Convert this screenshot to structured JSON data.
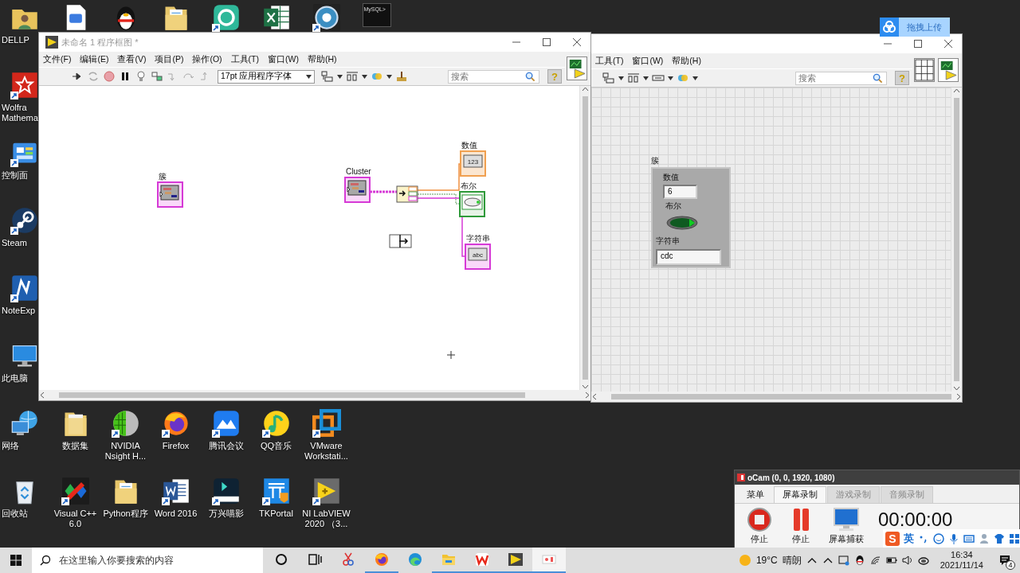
{
  "desktop": {
    "left_column": [
      {
        "kind": "user-folder",
        "label": "DELLP",
        "shortcut": false
      },
      {
        "kind": "wolfram",
        "label": "Wolfra\nMathema",
        "shortcut": true
      },
      {
        "kind": "control-panel",
        "label": "控制面",
        "shortcut": true
      },
      {
        "kind": "steam",
        "label": "Steam",
        "shortcut": true
      },
      {
        "kind": "noteexpress",
        "label": "NoteExp",
        "shortcut": true
      },
      {
        "kind": "computer",
        "label": "此电脑",
        "shortcut": false
      },
      {
        "kind": "network",
        "label": "网络",
        "shortcut": false
      },
      {
        "kind": "recycle",
        "label": "回收站",
        "shortcut": false
      }
    ],
    "top_row": [
      {
        "kind": "wps-doc",
        "shortcut": false
      },
      {
        "kind": "penguin",
        "shortcut": false
      },
      {
        "kind": "folder-docs",
        "shortcut": false
      },
      {
        "kind": "k-app",
        "shortcut": true
      },
      {
        "kind": "excel",
        "shortcut": false
      },
      {
        "kind": "s-app",
        "shortcut": true
      },
      {
        "kind": "terminal",
        "caption": "MySQL>",
        "shortcut": false
      }
    ],
    "bottom_rows": [
      [
        {
          "kind": "folder",
          "label": "数据集",
          "shortcut": false
        },
        {
          "kind": "nvidia",
          "label": "NVIDIA\nNsight H...",
          "shortcut": true
        },
        {
          "kind": "firefox",
          "label": "Firefox",
          "shortcut": true
        },
        {
          "kind": "meeting",
          "label": "腾讯会议",
          "shortcut": true
        },
        {
          "kind": "music",
          "label": "QQ音乐",
          "shortcut": true
        },
        {
          "kind": "vmware",
          "label": "VMware\nWorkstati...",
          "shortcut": true
        }
      ],
      [
        {
          "kind": "vc",
          "label": "Visual C++\n6.0",
          "shortcut": true
        },
        {
          "kind": "folder-docs",
          "label": "Python程序",
          "shortcut": false
        },
        {
          "kind": "word",
          "label": "Word 2016",
          "shortcut": true
        },
        {
          "kind": "wondershare",
          "label": "万兴喵影",
          "shortcut": true
        },
        {
          "kind": "tkportal",
          "label": "TKPortal",
          "shortcut": true
        },
        {
          "kind": "labview",
          "label": "NI LabVIEW\n2020 （3...",
          "shortcut": true
        }
      ]
    ]
  },
  "upload_widget": {
    "label": "拖拽上传"
  },
  "block_diagram": {
    "title": "未命名 1 程序框图 *",
    "menu": [
      "文件(F)",
      "编辑(E)",
      "查看(V)",
      "项目(P)",
      "操作(O)",
      "工具(T)",
      "窗口(W)",
      "帮助(H)"
    ],
    "font": "17pt 应用程序字体",
    "search_placeholder": "搜索",
    "help": "?",
    "nodes": [
      {
        "kind": "cluster",
        "label": "簇"
      },
      {
        "kind": "cluster",
        "label": "Cluster"
      },
      {
        "kind": "numeric",
        "label": "数值",
        "glyph": "123"
      },
      {
        "kind": "boolean",
        "label": "布尔"
      },
      {
        "kind": "string",
        "label": "字符串",
        "glyph": "abc"
      }
    ]
  },
  "front_panel": {
    "menu": [
      "工具(T)",
      "窗口(W)",
      "帮助(H)"
    ],
    "search_placeholder": "搜索",
    "help": "?",
    "cluster": {
      "label": "簇",
      "numeric": {
        "label": "数值",
        "value": "6"
      },
      "boolean": {
        "label": "布尔",
        "on": false
      },
      "string": {
        "label": "字符串",
        "value": "cdc"
      }
    }
  },
  "ocam": {
    "title": "oCam (0, 0, 1920, 1080)",
    "tabs": [
      {
        "label": "菜单",
        "selected": false
      },
      {
        "label": "屏幕录制",
        "selected": true
      },
      {
        "label": "游戏录制",
        "selected": false
      },
      {
        "label": "音频录制",
        "selected": false
      }
    ],
    "buttons": [
      {
        "kind": "record",
        "label": "停止"
      },
      {
        "kind": "pause",
        "label": "停止"
      },
      {
        "kind": "capture",
        "label": "屏幕捕获"
      }
    ],
    "timer": "00:00:00"
  },
  "ime": {
    "logo": "S",
    "mode": "英"
  },
  "taskbar": {
    "search_placeholder": "在这里输入你要搜索的内容",
    "apps": [
      {
        "kind": "cortana",
        "running": false,
        "selected": false
      },
      {
        "kind": "task-view",
        "running": false,
        "selected": false
      },
      {
        "kind": "snip",
        "running": false,
        "selected": false
      },
      {
        "kind": "firefox",
        "running": true,
        "selected": false
      },
      {
        "kind": "edge",
        "running": false,
        "selected": false
      },
      {
        "kind": "explorer",
        "running": true,
        "selected": false
      },
      {
        "kind": "wps",
        "running": true,
        "selected": false
      },
      {
        "kind": "labview",
        "running": true,
        "selected": false
      },
      {
        "kind": "ocam",
        "running": true,
        "selected": true
      }
    ],
    "weather": {
      "temp": "19°C",
      "condition": "晴朗"
    },
    "time": "16:34",
    "date": "2021/11/14",
    "notifications": "4"
  }
}
